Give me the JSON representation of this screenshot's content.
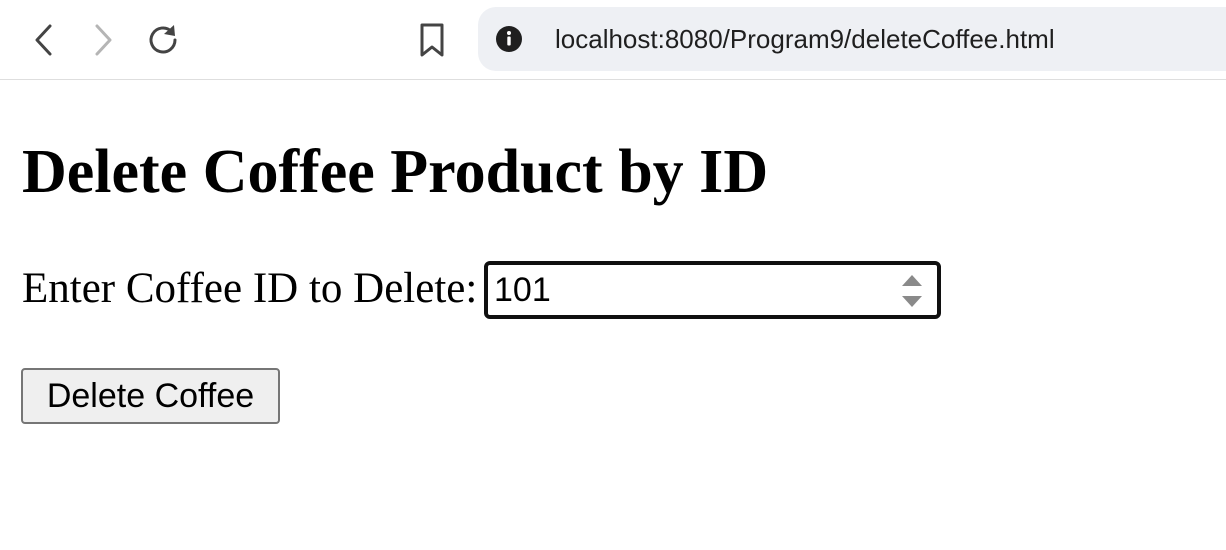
{
  "browser": {
    "url": "localhost:8080/Program9/deleteCoffee.html",
    "icons": {
      "back": "back-arrow-icon",
      "forward": "forward-arrow-icon",
      "reload": "reload-icon",
      "bookmark": "bookmark-icon",
      "site_info": "info-icon"
    }
  },
  "page": {
    "title": "Delete Coffee Product by ID",
    "form": {
      "id_label": "Enter Coffee ID to Delete:",
      "id_value": "101",
      "submit_label": "Delete Coffee"
    }
  },
  "colors": {
    "input_border": "#101010",
    "button_bg": "#efefef",
    "button_border": "#767676",
    "address_bar_bg": "#eef0f4"
  }
}
